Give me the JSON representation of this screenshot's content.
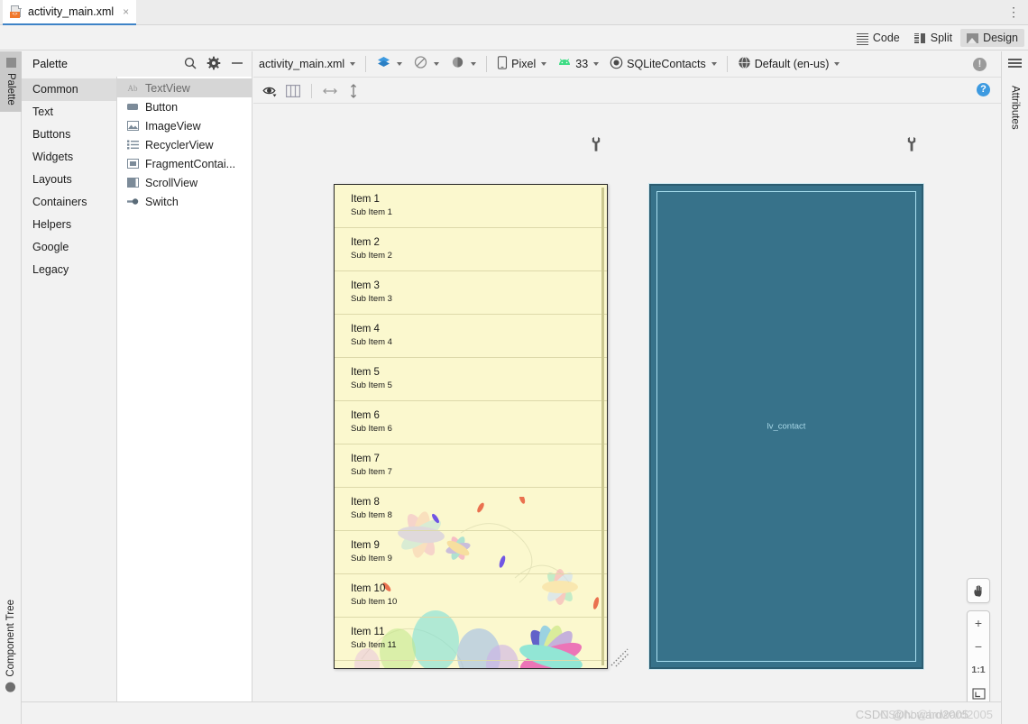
{
  "window": {
    "tab_title": "activity_main.xml",
    "tab_close": "×",
    "tab_menu": "⋮"
  },
  "modes": {
    "code": "Code",
    "split": "Split",
    "design": "Design",
    "active": "Design"
  },
  "left_strip": {
    "palette": "Palette",
    "component_tree": "Component Tree"
  },
  "right_strip": {
    "attributes": "Attributes"
  },
  "palette": {
    "title": "Palette",
    "search_icon": "search-icon",
    "gear_icon": "gear-icon",
    "minimize_icon": "minimize-icon",
    "categories": [
      {
        "label": "Common",
        "selected": true
      },
      {
        "label": "Text",
        "selected": false
      },
      {
        "label": "Buttons",
        "selected": false
      },
      {
        "label": "Widgets",
        "selected": false
      },
      {
        "label": "Layouts",
        "selected": false
      },
      {
        "label": "Containers",
        "selected": false
      },
      {
        "label": "Helpers",
        "selected": false
      },
      {
        "label": "Google",
        "selected": false
      },
      {
        "label": "Legacy",
        "selected": false
      }
    ],
    "items": [
      {
        "label": "TextView",
        "icon": "textview-icon",
        "selected": true
      },
      {
        "label": "Button",
        "icon": "button-icon",
        "selected": false
      },
      {
        "label": "ImageView",
        "icon": "imageview-icon",
        "selected": false
      },
      {
        "label": "RecyclerView",
        "icon": "recyclerview-icon",
        "selected": false
      },
      {
        "label": "FragmentContai...",
        "icon": "fragment-icon",
        "selected": false
      },
      {
        "label": "ScrollView",
        "icon": "scrollview-icon",
        "selected": false
      },
      {
        "label": "Switch",
        "icon": "switch-icon",
        "selected": false
      }
    ]
  },
  "config_bar": {
    "file": "activity_main.xml",
    "theme_icon": "theme-layers-icon",
    "no_theme_icon": "no-theme-icon",
    "ui_mode_icon": "ui-mode-icon",
    "device": "Pixel",
    "device_icon": "phone-icon",
    "api": "33",
    "api_icon": "android-icon",
    "theme": "SQLiteContacts",
    "theme_sel_icon": "theme-icon",
    "locale": "Default (en-us)",
    "locale_icon": "globe-icon",
    "issue_icon": "!",
    "help_icon": "?"
  },
  "surface_toolbar": {
    "eye_icon": "eye-visibility-icon",
    "panes_icon": "design-blueprint-panes-icon",
    "hconstraint_icon": "horizontal-arrow-icon",
    "vconstraint_icon": "vertical-arrow-icon"
  },
  "preview": {
    "wrench_icon": "wrench-icon",
    "list": {
      "rows": [
        {
          "title": "Item 1",
          "sub": "Sub Item 1"
        },
        {
          "title": "Item 2",
          "sub": "Sub Item 2"
        },
        {
          "title": "Item 3",
          "sub": "Sub Item 3"
        },
        {
          "title": "Item 4",
          "sub": "Sub Item 4"
        },
        {
          "title": "Item 5",
          "sub": "Sub Item 5"
        },
        {
          "title": "Item 6",
          "sub": "Sub Item 6"
        },
        {
          "title": "Item 7",
          "sub": "Sub Item 7"
        },
        {
          "title": "Item 8",
          "sub": "Sub Item 8"
        },
        {
          "title": "Item 9",
          "sub": "Sub Item 9"
        },
        {
          "title": "Item 10",
          "sub": "Sub Item 10"
        },
        {
          "title": "Item 11",
          "sub": "Sub Item 11"
        }
      ],
      "background_color": "#fbf8ce"
    }
  },
  "blueprint": {
    "wrench_icon": "wrench-icon",
    "component_label": "lv_contact",
    "fill_color": "#37728a",
    "stroke_color": "#a9dff0"
  },
  "zoom_controls": {
    "pan_icon": "pan-hand-icon",
    "zoom_in": "+",
    "zoom_out": "−",
    "actual_size": "1:1",
    "fit_icon": "zoom-to-fit-icon"
  },
  "status_bar": {
    "watermark_a": "CSDN @howard2005",
    "watermark_b": "CSDN @howard2005"
  }
}
